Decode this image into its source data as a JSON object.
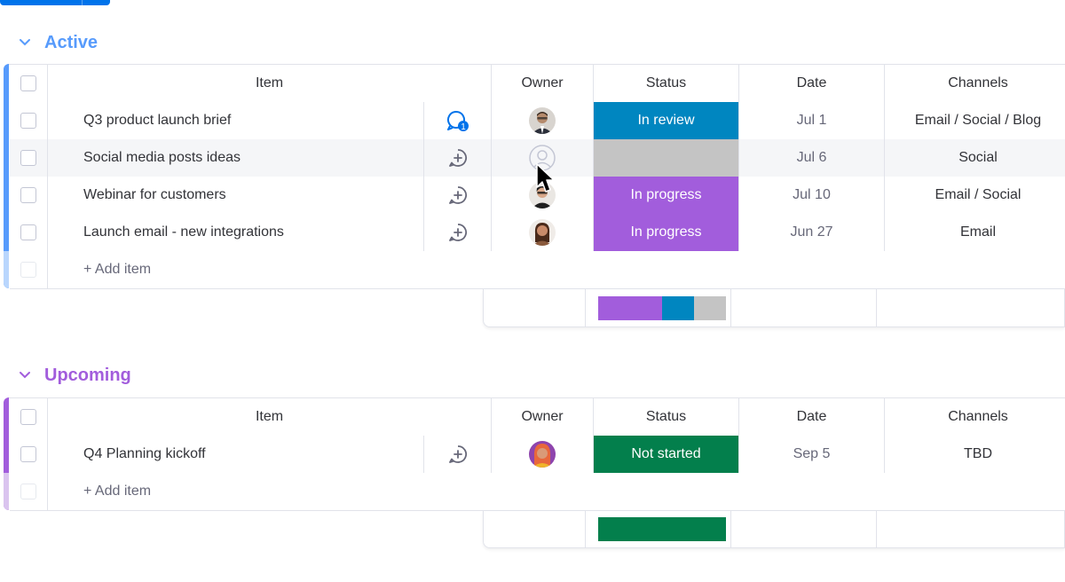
{
  "colors": {
    "active_group": "#579bfc",
    "upcoming_group": "#a25ddc",
    "in_review": "#0086c0",
    "in_progress": "#a25ddc",
    "not_started": "#037f4c",
    "empty_status": "#c4c4c4",
    "conversation_active": "#0073ea",
    "conversation_idle": "#676879"
  },
  "columns": {
    "item": "Item",
    "owner": "Owner",
    "status": "Status",
    "date": "Date",
    "channels": "Channels"
  },
  "groups": [
    {
      "title": "Active",
      "add_item": "+ Add item",
      "rows": [
        {
          "item": "Q3 product launch brief",
          "updates_badge": "1",
          "status": "In review",
          "date": "Jul 1",
          "channels": "Email / Social / Blog"
        },
        {
          "item": "Social media posts ideas",
          "status": "",
          "date": "Jul 6",
          "channels": "Social"
        },
        {
          "item": "Webinar for customers",
          "status": "In progress",
          "date": "Jul 10",
          "channels": "Email / Social"
        },
        {
          "item": "Launch email - new integrations",
          "status": "In progress",
          "date": "Jun 27",
          "channels": "Email"
        }
      ],
      "status_summary": [
        {
          "status": "In progress",
          "fraction": 0.5
        },
        {
          "status": "In review",
          "fraction": 0.25
        },
        {
          "status": "Empty",
          "fraction": 0.25
        }
      ]
    },
    {
      "title": "Upcoming",
      "add_item": "+ Add item",
      "rows": [
        {
          "item": "Q4 Planning kickoff",
          "status": "Not started",
          "date": "Sep 5",
          "channels": "TBD"
        }
      ],
      "status_summary": [
        {
          "status": "Not started",
          "fraction": 1.0
        }
      ]
    }
  ]
}
